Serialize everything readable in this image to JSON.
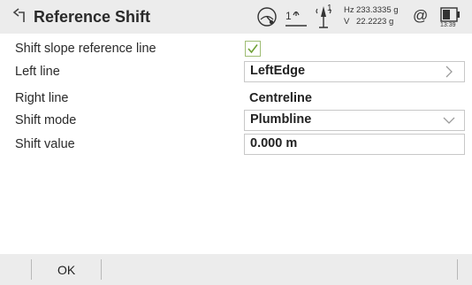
{
  "header": {
    "title": "Reference Shift",
    "link_number": "1",
    "prism_number": "1",
    "hz_label": "Hz",
    "hz_value": "233.3335 g",
    "v_label": "V",
    "v_value": "22.2223 g",
    "at_symbol": "@",
    "time": "13:39",
    "icons": [
      "back-arrow-icon",
      "gnss-icon",
      "link-icon",
      "prism-icon",
      "at-icon",
      "battery-icon"
    ]
  },
  "form": {
    "shift_slope": {
      "label": "Shift slope reference line",
      "checked": true
    },
    "left_line": {
      "label": "Left line",
      "value": "LeftEdge"
    },
    "right_line": {
      "label": "Right line",
      "value": "Centreline"
    },
    "shift_mode": {
      "label": "Shift mode",
      "value": "Plumbline"
    },
    "shift_value": {
      "label": "Shift value",
      "value": "0.000 m"
    }
  },
  "softkeys": {
    "ok_label": "OK"
  },
  "colors": {
    "bar_background": "#ececec",
    "checkbox_green": "#6fa035",
    "field_border": "#c8c8c8"
  }
}
